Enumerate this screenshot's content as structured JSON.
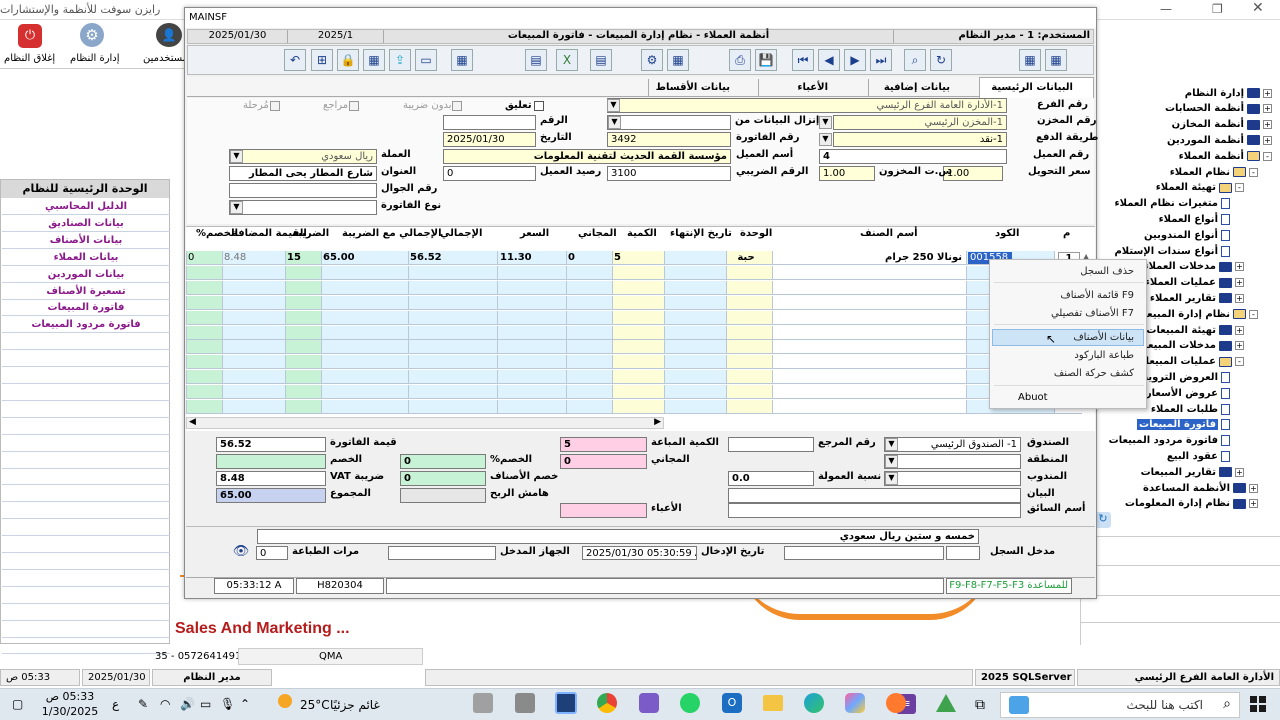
{
  "app": {
    "title": "رايزن سوفت للأنظمة والإستشارات",
    "close_label": "إغلاق النظام",
    "admin_label": "إدارة النظام",
    "users_label": "مستخدمين"
  },
  "left_panel": {
    "header": "الوحدة الرئيسية للنظام",
    "items": [
      "الدليل المحاسبي",
      "بيانات الصناديق",
      "بيانات الأصناف",
      "بيانات العملاء",
      "بيانات الموردين",
      "تسعيرة الأصناف",
      "فاتورة المبيعات",
      "فاتورة مردود المبيعات"
    ]
  },
  "tree": {
    "items": [
      {
        "label": "إدارة النظام",
        "type": "folder",
        "pm": "+"
      },
      {
        "label": "أنظمة الحسابات",
        "type": "folder",
        "pm": "+"
      },
      {
        "label": "أنظمة المخازن",
        "type": "folder",
        "pm": "+"
      },
      {
        "label": "أنظمة الموردين",
        "type": "folder",
        "pm": "+"
      },
      {
        "label": "أنظمة العملاء",
        "type": "book",
        "pm": "-"
      },
      {
        "label": "نظام العملاء",
        "type": "book",
        "pm": "-"
      },
      {
        "label": "تهيئة العملاء",
        "type": "book",
        "pm": "-"
      },
      {
        "label": "متغيرات نظام العملاء",
        "type": "doc",
        "pm": ""
      },
      {
        "label": "أنواع العملاء",
        "type": "doc",
        "pm": ""
      },
      {
        "label": "أنواع المندوبين",
        "type": "doc",
        "pm": ""
      },
      {
        "label": "أنواع سندات الإستلام",
        "type": "doc",
        "pm": ""
      },
      {
        "label": "مدخلات العملاء",
        "type": "folder",
        "pm": "+"
      },
      {
        "label": "عمليات العملاء",
        "type": "folder",
        "pm": "+"
      },
      {
        "label": "تقارير العملاء",
        "type": "folder",
        "pm": "+"
      },
      {
        "label": "نظام إدارة المبيعات",
        "type": "book",
        "pm": "-"
      },
      {
        "label": "تهيئة المبيعات",
        "type": "folder",
        "pm": "+"
      },
      {
        "label": "مدخلات المبيعات",
        "type": "folder",
        "pm": "+"
      },
      {
        "label": "عمليات المبيعات",
        "type": "book",
        "pm": "-"
      },
      {
        "label": "العروض الترويجية",
        "type": "doc",
        "pm": ""
      },
      {
        "label": "عروض الأسعار",
        "type": "doc",
        "pm": ""
      },
      {
        "label": "طلبات العملاء",
        "type": "doc",
        "pm": ""
      },
      {
        "label": "فاتورة المبيعات",
        "type": "doc",
        "pm": "",
        "selected": true
      },
      {
        "label": "فاتورة مردود المبيعات",
        "type": "doc",
        "pm": ""
      },
      {
        "label": "عقود البيع",
        "type": "doc",
        "pm": ""
      },
      {
        "label": "تقارير المبيعات",
        "type": "folder",
        "pm": "+"
      },
      {
        "label": "الأنظمة المساعدة",
        "type": "folder",
        "pm": "+"
      },
      {
        "label": "نظام إدارة المعلومات",
        "type": "folder",
        "pm": "+"
      }
    ]
  },
  "window": {
    "title": "MAINSF",
    "date": "2025/01/30",
    "period": "2025/1",
    "breadcrumb": "أنظمة العملاء - نظام إدارة المبيعات - فاتورة المبيعات",
    "user": "المستخدم: 1 - مدير النظام"
  },
  "tabs": [
    "البيانات الرئيسية",
    "بيانات إضافية",
    "الأعباء",
    "بيانات الأقساط"
  ],
  "form": {
    "branch_label": "رقم الفرع",
    "branch_value": "1-الأدارة العامة الفرع الرئيسي",
    "store_label": "رقم المخزن",
    "store_value": "1-المخزن الرئيسي",
    "pay_label": "طريقة الدفع",
    "pay_value": "1-نقد",
    "customer_no_label": "رقم العميل",
    "customer_no_value": "4",
    "rate_label": "سعر التحويل",
    "rate_value": "1.00",
    "stock_rate_label": "س.ت المخزون",
    "stock_rate_value": "1.00",
    "load_from_label": "إنزال البيانات من",
    "number_label": "الرقم",
    "number_value": "",
    "invoice_no_label": "رقم الفاتورة",
    "invoice_no_value": "3492",
    "date_label": "التاريخ",
    "date_value": "2025/01/30",
    "customer_name_label": "أسم العميل",
    "customer_name_value": "مؤسسة القمة الحديث لتقنية المعلومات",
    "balance_label": "رصيد العميل",
    "balance_value": "0",
    "tax_no_label": "الرقم الضريبي",
    "tax_no_value": "3100",
    "currency_label": "العملة",
    "currency_value": "ريال سعودي",
    "address_label": "العنوان",
    "address_value": "شارع المطار يحى المطار",
    "mobile_label": "رقم الجوال",
    "mobile_value": "",
    "invoice_type_label": "نوع الفاتورة",
    "invoice_type_value": "",
    "chk_hang": "تعليق",
    "chk_notax": "بدون ضريبة",
    "chk_review": "مراجع",
    "chk_post": "مُرحلة"
  },
  "grid": {
    "headers": [
      "م",
      "الكود",
      "أسم الصنف",
      "الوحدة",
      "تاريخ الإنتهاء",
      "الكمية",
      "المجاني",
      "السعر",
      "الإجمالي",
      "الإجمالي مع الضريبة",
      "الضريبة",
      "القيمة المضافة",
      "الخصم%"
    ],
    "row": {
      "num": "1",
      "code": "001558",
      "name": "نونالا 250 جرام",
      "unit": "حبة",
      "expiry": "",
      "qty": "5",
      "free": "0",
      "price": "11.30",
      "total": "56.52",
      "total_tax": "65.00",
      "tax": "15",
      "vat": "8.48",
      "disc": "0"
    }
  },
  "context_menu": {
    "items": [
      "حذف السجل",
      "F9 قائمة الأصناف",
      "F7 الأصناف تفصيلي",
      "بيانات الأصناف",
      "طباعة الباركود",
      "كشف حركة الصنف",
      "Abuot"
    ]
  },
  "summary": {
    "invoice_value_label": "قيمة الفاتورة",
    "invoice_value": "56.52",
    "discount_label": "الخصم",
    "discount_value": "",
    "vat_label": "ضريبة VAT",
    "vat_value": "8.48",
    "total_label": "المجموع",
    "total_value": "65.00",
    "sold_qty_label": "الكمية المباعة",
    "sold_qty_value": "5",
    "free_label": "المجاني",
    "free_value": "0",
    "disc_pct_label": "الخصم%",
    "disc_pct_value": "0",
    "item_disc_label": "خصم الأصناف",
    "item_disc_value": "0",
    "margin_label": "هامش الربح",
    "margin_value": "",
    "burdens_label": "الأعباء",
    "burdens_value": "",
    "ref_label": "رقم المرجع",
    "ref_value": "",
    "box_label": "الصندوق",
    "box_value": "1- الصندوق الرئيسي",
    "area_label": "المنطقة",
    "area_value": "",
    "rep_label": "المندوب",
    "rep_value": "",
    "commission_label": "نسبة العمولة",
    "commission_value": "0.0",
    "statement_label": "البيان",
    "statement_value": "",
    "driver_label": "أسم السائق",
    "driver_value": "",
    "words": "خمسه و ستين ريال سعودي",
    "entered_by_label": "مدخل السجل",
    "entry_date_label": "تاريخ الإدخال",
    "entry_date_value": "2025/01/30 05:30:59 A",
    "device_label": "الجهاز المدخل",
    "prints_label": "مرات الطباعة",
    "prints_value": "0"
  },
  "footer": {
    "time": "05:33:12 A",
    "host": "H820304",
    "help": "للمساعدة F9-F8-F7-F5-F3"
  },
  "background": {
    "sales_text": "Sales And Marketing ..."
  },
  "status_bar": {
    "branch": "الأدارة العامة الفرع الرئيسي",
    "server": "2025 SQLServer",
    "user": "مدير النظام",
    "date": "2025/01/30",
    "time": "05:33 ص",
    "db": "QMA",
    "phone": "35 - 0572641491 - C"
  },
  "taskbar": {
    "search": "اكتب هنا للبحث",
    "weather": "غائم جزئيًا",
    "temp": "25°C",
    "clock_time": "05:33 ص",
    "clock_date": "1/30/2025",
    "lang": "ع"
  }
}
